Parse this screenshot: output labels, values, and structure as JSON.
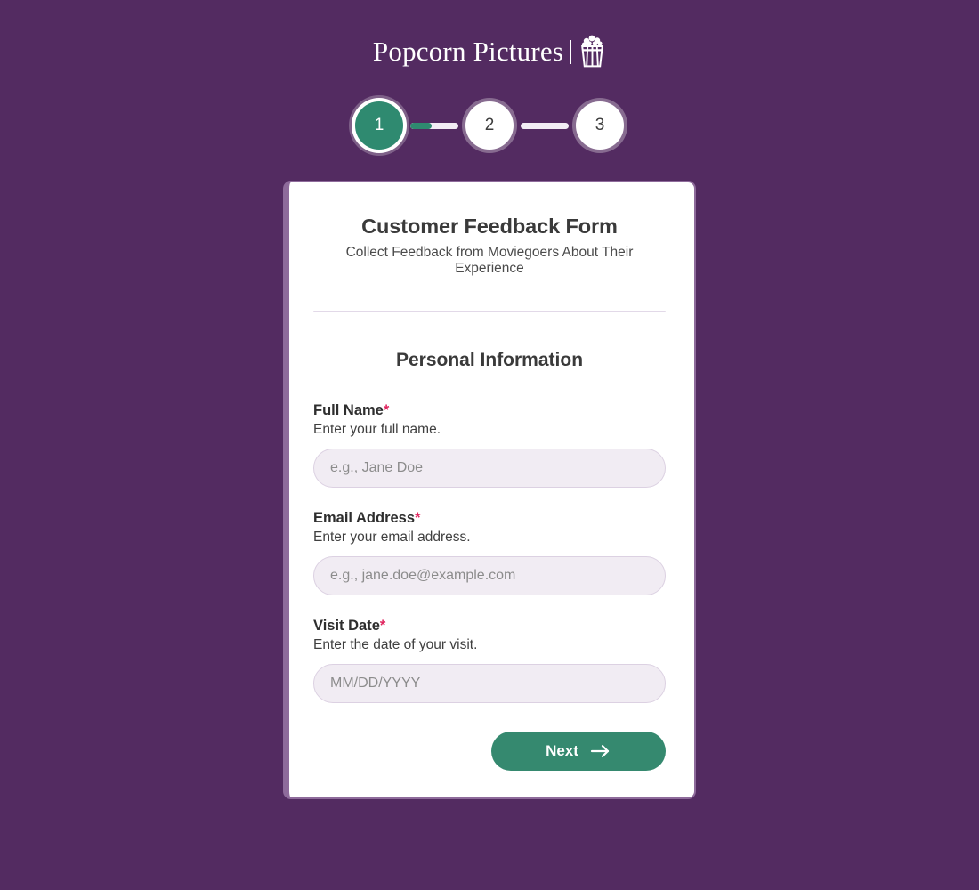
{
  "brand": {
    "name": "Popcorn Pictures",
    "divider": "|",
    "icon": "popcorn-box-icon"
  },
  "stepper": {
    "steps": [
      {
        "label": "1",
        "state": "active"
      },
      {
        "label": "2",
        "state": "inactive"
      },
      {
        "label": "3",
        "state": "inactive"
      }
    ],
    "connectors": [
      {
        "fill_percent": 45
      },
      {
        "fill_percent": 0
      }
    ],
    "active_color": "#2F8A70",
    "inactive_color": "#FFFFFF"
  },
  "card": {
    "title": "Customer Feedback Form",
    "subtitle": "Collect Feedback from Moviegoers About Their Experience",
    "section_title": "Personal Information",
    "accent_color": "#8E6B9B",
    "fields": [
      {
        "label": "Full Name",
        "required_marker": "*",
        "help": "Enter your full name.",
        "placeholder": "e.g., Jane Doe",
        "value": ""
      },
      {
        "label": "Email Address",
        "required_marker": "*",
        "help": "Enter your email address.",
        "placeholder": "e.g., jane.doe@example.com",
        "value": ""
      },
      {
        "label": "Visit Date",
        "required_marker": "*",
        "help": "Enter the date of your visit.",
        "placeholder": "MM/DD/YYYY",
        "value": ""
      }
    ],
    "next_button": {
      "label": "Next",
      "icon": "arrow-right-icon",
      "color": "#35896F"
    }
  },
  "theme": {
    "background": "#532B61",
    "required_color": "#E0245E",
    "input_background": "#F1ECF3",
    "input_border": "#DCD1E2"
  }
}
